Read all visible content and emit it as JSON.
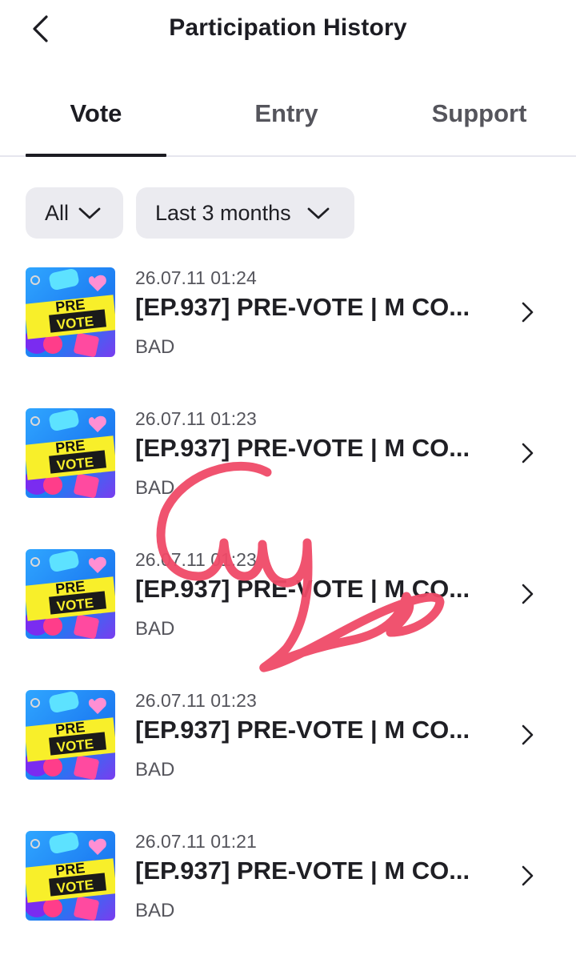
{
  "header": {
    "title": "Participation History",
    "back_icon": "chevron-left-icon"
  },
  "tabs": [
    {
      "label": "Vote",
      "active": true
    },
    {
      "label": "Entry",
      "active": false
    },
    {
      "label": "Support",
      "active": false
    }
  ],
  "filters": {
    "type": {
      "label": "All",
      "icon": "chevron-down-icon"
    },
    "period": {
      "label": "Last 3 months",
      "icon": "chevron-down-icon"
    }
  },
  "items": [
    {
      "date": "26.07.11 01:24",
      "title": "[EP.937] PRE-VOTE | M CO...",
      "subtitle": "BAD",
      "thumb_text": [
        "PRE",
        "VOTE"
      ]
    },
    {
      "date": "26.07.11 01:23",
      "title": "[EP.937] PRE-VOTE | M CO...",
      "subtitle": "BAD",
      "thumb_text": [
        "PRE",
        "VOTE"
      ]
    },
    {
      "date": "26.07.11 01:23",
      "title": "[EP.937] PRE-VOTE | M CO...",
      "subtitle": "BAD",
      "thumb_text": [
        "PRE",
        "VOTE"
      ]
    },
    {
      "date": "26.07.11 01:23",
      "title": "[EP.937] PRE-VOTE | M CO...",
      "subtitle": "BAD",
      "thumb_text": [
        "PRE",
        "VOTE"
      ]
    },
    {
      "date": "26.07.11 01:21",
      "title": "[EP.937] PRE-VOTE | M CO...",
      "subtitle": "BAD",
      "thumb_text": [
        "PRE",
        "VOTE"
      ]
    }
  ],
  "colors": {
    "text_primary": "#1c1c22",
    "text_secondary": "#55555c",
    "chip_bg": "#ebebf0",
    "divider": "#e6e6ee",
    "scribble": "#ef4a67"
  }
}
